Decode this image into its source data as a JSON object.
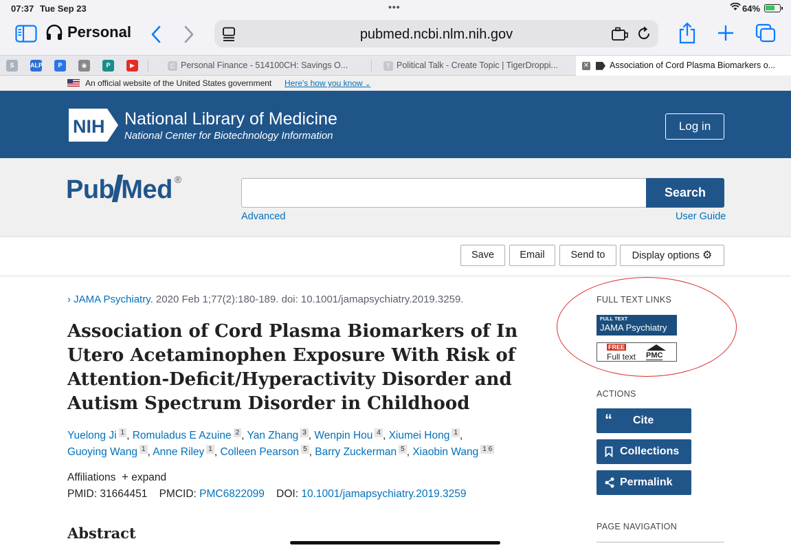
{
  "status_bar": {
    "time": "07:37",
    "date": "Tue Sep 23",
    "battery": "64%"
  },
  "browser": {
    "profile": "Personal",
    "url": "pubmed.ncbi.nlm.nih.gov",
    "pinned_tabs": [
      {
        "icon": "S",
        "color": "#a9b2bd"
      },
      {
        "icon": "ALP",
        "color": "#2f6fd3"
      },
      {
        "icon": "P",
        "color": "#2a74e8"
      },
      {
        "icon": "◉",
        "color": "#888888"
      },
      {
        "icon": "P",
        "color": "#1a8c8c"
      },
      {
        "icon": "▶",
        "color": "#e52d27"
      }
    ],
    "tabs": [
      {
        "favicon": "C",
        "title": "Personal Finance - 514100CH: Savings O..."
      },
      {
        "favicon": "T",
        "title": "Political Talk - Create Topic | TigerDroppi..."
      },
      {
        "favicon": "",
        "title": "Association of Cord Plasma Biomarkers o..."
      }
    ]
  },
  "gov_banner": {
    "text": "An official website of the United States government",
    "link": "Here's how you know"
  },
  "nlm_header": {
    "logo": "NIH",
    "title": "National Library of Medicine",
    "subtitle": "National Center for Biotechnology Information",
    "login": "Log in"
  },
  "search": {
    "logo_pub": "Pub",
    "logo_med": "Med",
    "logo_reg": "®",
    "value": "",
    "button": "Search",
    "advanced": "Advanced",
    "user_guide": "User Guide"
  },
  "action_buttons": {
    "save": "Save",
    "email": "Email",
    "send_to": "Send to",
    "display": "Display options"
  },
  "article": {
    "journal": "JAMA Psychiatry.",
    "citation": " 2020 Feb 1;77(2):180-189. doi: 10.1001/jamapsychiatry.2019.3259.",
    "title": "Association of Cord Plasma Biomarkers of In Utero Acetaminophen Exposure With Risk of Attention-Deficit/Hyperactivity Disorder and Autism Spectrum Disorder in Childhood",
    "authors": [
      {
        "name": "Yuelong Ji",
        "aff": "1"
      },
      {
        "name": "Romuladus E Azuine",
        "aff": "2"
      },
      {
        "name": "Yan Zhang",
        "aff": "3"
      },
      {
        "name": "Wenpin Hou",
        "aff": "4"
      },
      {
        "name": "Xiumei Hong",
        "aff": "1"
      },
      {
        "name": "Guoying Wang",
        "aff": "1"
      },
      {
        "name": "Anne Riley",
        "aff": "1"
      },
      {
        "name": "Colleen Pearson",
        "aff": "5"
      },
      {
        "name": "Barry Zuckerman",
        "aff": "5"
      },
      {
        "name": "Xiaobin Wang",
        "aff": "1 6"
      }
    ],
    "affiliations": "Affiliations",
    "expand": "expand",
    "pmid_label": "PMID:",
    "pmid": "31664451",
    "pmcid_label": "PMCID:",
    "pmcid": "PMC6822099",
    "doi_label": "DOI:",
    "doi": "10.1001/jamapsychiatry.2019.3259",
    "abstract_heading": "Abstract"
  },
  "sidebar": {
    "full_text_heading": "FULL TEXT LINKS",
    "jama_badge_top": "FULL TEXT",
    "jama_badge_name": "JAMA Psychiatry",
    "pmc_free": "FREE",
    "pmc_full": "Full text",
    "pmc_label": "PMC",
    "actions_heading": "ACTIONS",
    "cite": "Cite",
    "collections": "Collections",
    "permalink": "Permalink",
    "page_nav_heading": "PAGE NAVIGATION"
  },
  "colors": {
    "nlm_blue": "#20558a",
    "link_blue": "#0071bc",
    "annotation_red": "#e02b2b"
  }
}
